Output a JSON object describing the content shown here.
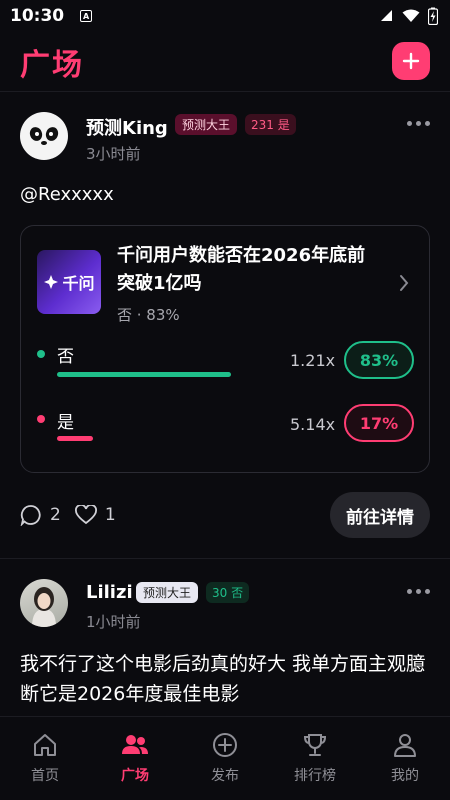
{
  "status": {
    "time": "10:30",
    "notification_glyph": "A"
  },
  "header": {
    "title": "广场",
    "add_icon": "plus-icon"
  },
  "post1": {
    "username": "预测King",
    "badge": "预测大王",
    "stat": "231 是",
    "time_ago": "3小时前",
    "content": "@Rexxxxx",
    "question": {
      "thumbnail_text": "千问",
      "title": "千问用户数能否在2026年底前突破1亿吗",
      "subtitle": "否 · 83%",
      "options": [
        {
          "label": "否",
          "odds": "1.21x",
          "percent": "83%",
          "fill": 0.83,
          "color": "#1fbf8a"
        },
        {
          "label": "是",
          "odds": "5.14x",
          "percent": "17%",
          "fill": 0.17,
          "color": "#ff3d73"
        }
      ]
    },
    "comments": "2",
    "likes": "1",
    "detail_button": "前往详情"
  },
  "post2": {
    "username": "Lilizi",
    "badge": "预测大王",
    "stat": "30 否",
    "time_ago": "1小时前",
    "content": "我不行了这个电影后劲真的好大 我单方面主观臆断它是2026年度最佳电影"
  },
  "tabs": [
    {
      "label": "首页",
      "icon": "home-icon",
      "active": false
    },
    {
      "label": "广场",
      "icon": "people-icon",
      "active": true
    },
    {
      "label": "发布",
      "icon": "add-circle-icon",
      "active": false
    },
    {
      "label": "排行榜",
      "icon": "trophy-icon",
      "active": false
    },
    {
      "label": "我的",
      "icon": "profile-icon",
      "active": false
    }
  ],
  "colors": {
    "accent": "#ff3d73",
    "positive": "#1fbf8a",
    "background": "#0b0b0f"
  }
}
